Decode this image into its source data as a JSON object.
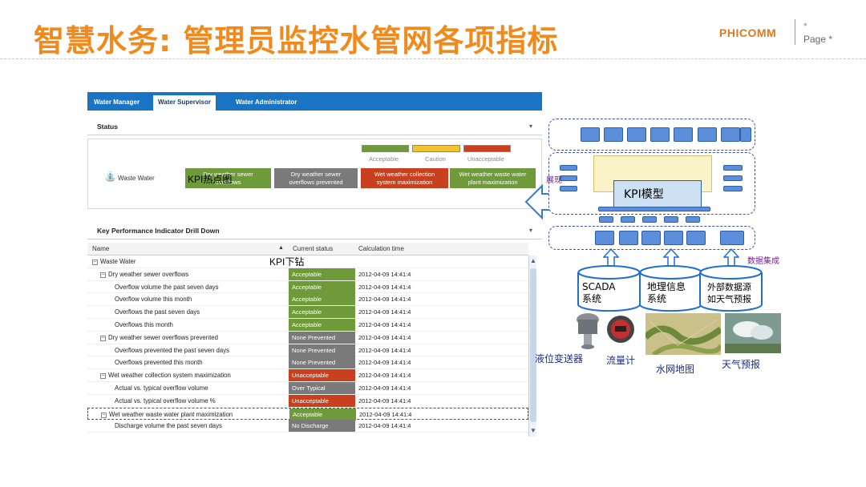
{
  "slide": {
    "title": "智慧水务: 管理员监控水管网各项指标",
    "brand": "PHICOMM",
    "page_dot": "*",
    "page_label": "Page *"
  },
  "dashboard": {
    "tabs": [
      "Water Manager",
      "Water Supervisor",
      "Water Administrator"
    ],
    "active_tab": "Water Supervisor",
    "status_title": "Status",
    "legend": [
      {
        "label": "Acceptable",
        "color": "#6f9a3a"
      },
      {
        "label": "Caution",
        "color": "#f2c230"
      },
      {
        "label": "Unacceptable",
        "color": "#c8401e"
      }
    ],
    "status_row_label": "Waste Water",
    "heat_cells": [
      {
        "line1": "Dry weather sewer",
        "line2": "overflows",
        "color": "#6f9a3a"
      },
      {
        "line1": "Dry weather sewer",
        "line2": "overflows prevented",
        "color": "#7a7a7a"
      },
      {
        "line1": "Wet weather collection",
        "line2": "system maximization",
        "color": "#c8401e"
      },
      {
        "line1": "Wet weather waste water",
        "line2": "plant maximization",
        "color": "#6f9a3a"
      }
    ],
    "overlay_heatmap": "KPI热点图",
    "overlay_drilldown": "KPI下钻",
    "drilldown_title": "Key Performance Indicator Drill Down",
    "columns": [
      "Name",
      "Current status",
      "Calculation time"
    ],
    "rows": [
      {
        "indent": 0,
        "toggle": "−",
        "name": "Waste Water",
        "status": "",
        "color": "",
        "time": ""
      },
      {
        "indent": 1,
        "toggle": "−",
        "name": "Dry weather sewer overflows",
        "status": "Acceptable",
        "color": "#6f9a3a",
        "time": "2012-04-09 14:41:4"
      },
      {
        "indent": 2,
        "toggle": "",
        "name": "Overflow volume the past seven days",
        "status": "Acceptable",
        "color": "#6f9a3a",
        "time": "2012-04-09 14:41:4"
      },
      {
        "indent": 2,
        "toggle": "",
        "name": "Overflow volume this month",
        "status": "Acceptable",
        "color": "#6f9a3a",
        "time": "2012-04-09 14:41:4"
      },
      {
        "indent": 2,
        "toggle": "",
        "name": "Overflows the past seven days",
        "status": "Acceptable",
        "color": "#6f9a3a",
        "time": "2012-04-09 14:41:4"
      },
      {
        "indent": 2,
        "toggle": "",
        "name": "Overflows this month",
        "status": "Acceptable",
        "color": "#6f9a3a",
        "time": "2012-04-09 14:41:4"
      },
      {
        "indent": 1,
        "toggle": "−",
        "name": "Dry weather sewer overflows prevented",
        "status": "None Prevented",
        "color": "#7a7a7a",
        "time": "2012-04-09 14:41:4"
      },
      {
        "indent": 2,
        "toggle": "",
        "name": "Overflows prevented the past seven days",
        "status": "None Prevented",
        "color": "#7a7a7a",
        "time": "2012-04-09 14:41:4"
      },
      {
        "indent": 2,
        "toggle": "",
        "name": "Overflows prevented this month",
        "status": "None Prevented",
        "color": "#7a7a7a",
        "time": "2012-04-09 14:41:4"
      },
      {
        "indent": 1,
        "toggle": "−",
        "name": "Wet weather collection system maximization",
        "status": "Unacceptable",
        "color": "#c8401e",
        "time": "2012-04-09 14:41:4"
      },
      {
        "indent": 2,
        "toggle": "",
        "name": "Actual vs. typical overflow volume",
        "status": "Over Typical",
        "color": "#7a7a7a",
        "time": "2012-04-09 14:41:4"
      },
      {
        "indent": 2,
        "toggle": "",
        "name": "Actual vs. typical overflow volume %",
        "status": "Unacceptable",
        "color": "#c8401e",
        "time": "2012-04-09 14:41:4"
      },
      {
        "indent": 1,
        "toggle": "−",
        "name": "Wet weather waste water plant maximization",
        "status": "Acceptable",
        "color": "#6f9a3a",
        "time": "2012-04-09 14:41:4"
      },
      {
        "indent": 2,
        "toggle": "",
        "name": "Discharge volume the past seven days",
        "status": "No Discharge",
        "color": "#7a7a7a",
        "time": "2012-04-09 14:41:4"
      }
    ]
  },
  "diagram": {
    "kpi_model": "KPI模型",
    "label_display": "展现",
    "label_data_integration": "数据集成",
    "cylinders": [
      {
        "line1": "SCADA",
        "line2": "系统"
      },
      {
        "line1": "地理信息",
        "line2": "系统"
      },
      {
        "line1": "外部数据源",
        "line2": "如天气预报"
      }
    ],
    "devices": {
      "level_transmitter": "液位变送器",
      "flow_meter": "流量计",
      "network_map": "水网地图",
      "weather": "天气预报"
    },
    "colors": {
      "accent_orange": "#f08a1c",
      "cylinder_blue": "#1e6fd0",
      "arrow_blue": "#3a7bd0"
    }
  }
}
